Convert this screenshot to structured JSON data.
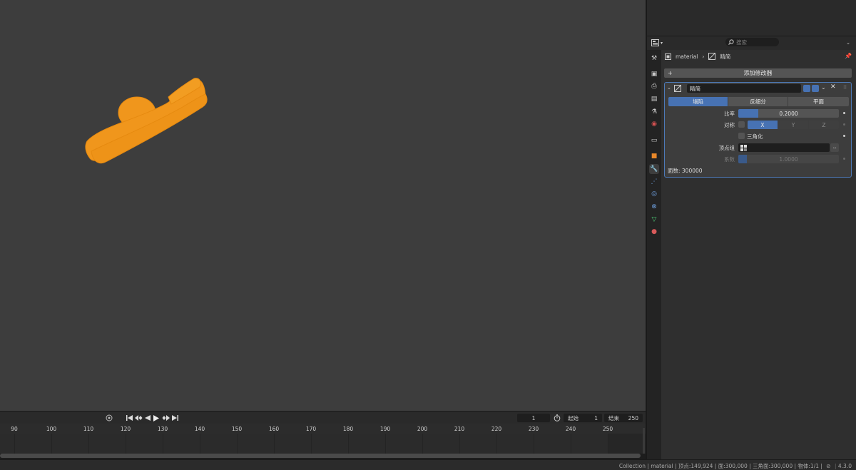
{
  "viewport": {
    "background": "#3d3d3d",
    "object_color": "#f0961c"
  },
  "timeline": {
    "current_frame": "1",
    "start_label": "起始",
    "start_value": "1",
    "end_label": "结束",
    "end_value": "250",
    "ruler_ticks": [
      "90",
      "100",
      "110",
      "120",
      "130",
      "140",
      "150",
      "160",
      "170",
      "180",
      "190",
      "200",
      "210",
      "220",
      "230",
      "240",
      "250"
    ]
  },
  "properties": {
    "search_placeholder": "搜索",
    "breadcrumb": {
      "object": "material",
      "modifier": "精简"
    },
    "add_modifier": "添加修改器",
    "modifier": {
      "name": "精简",
      "modes": [
        "塌陷",
        "反细分",
        "平面"
      ],
      "active_mode": 0,
      "ratio_label": "比率",
      "ratio_value": "0.2000",
      "ratio_fraction": 0.2,
      "symmetry_label": "对称",
      "axes": [
        "X",
        "Y",
        "Z"
      ],
      "active_axis": 0,
      "triangulate_label": "三角化",
      "vertex_group_label": "顶点组",
      "factor_label": "系数",
      "factor_value": "1.0000",
      "face_count": "面数: 300000"
    },
    "accent_color": "#4772b3"
  },
  "statusbar": {
    "stats": "Collection | material | 顶点:149,924 | 面:300,000 | 三角面:300,000 | 物体:1/1 |",
    "version": "4.3.0"
  }
}
